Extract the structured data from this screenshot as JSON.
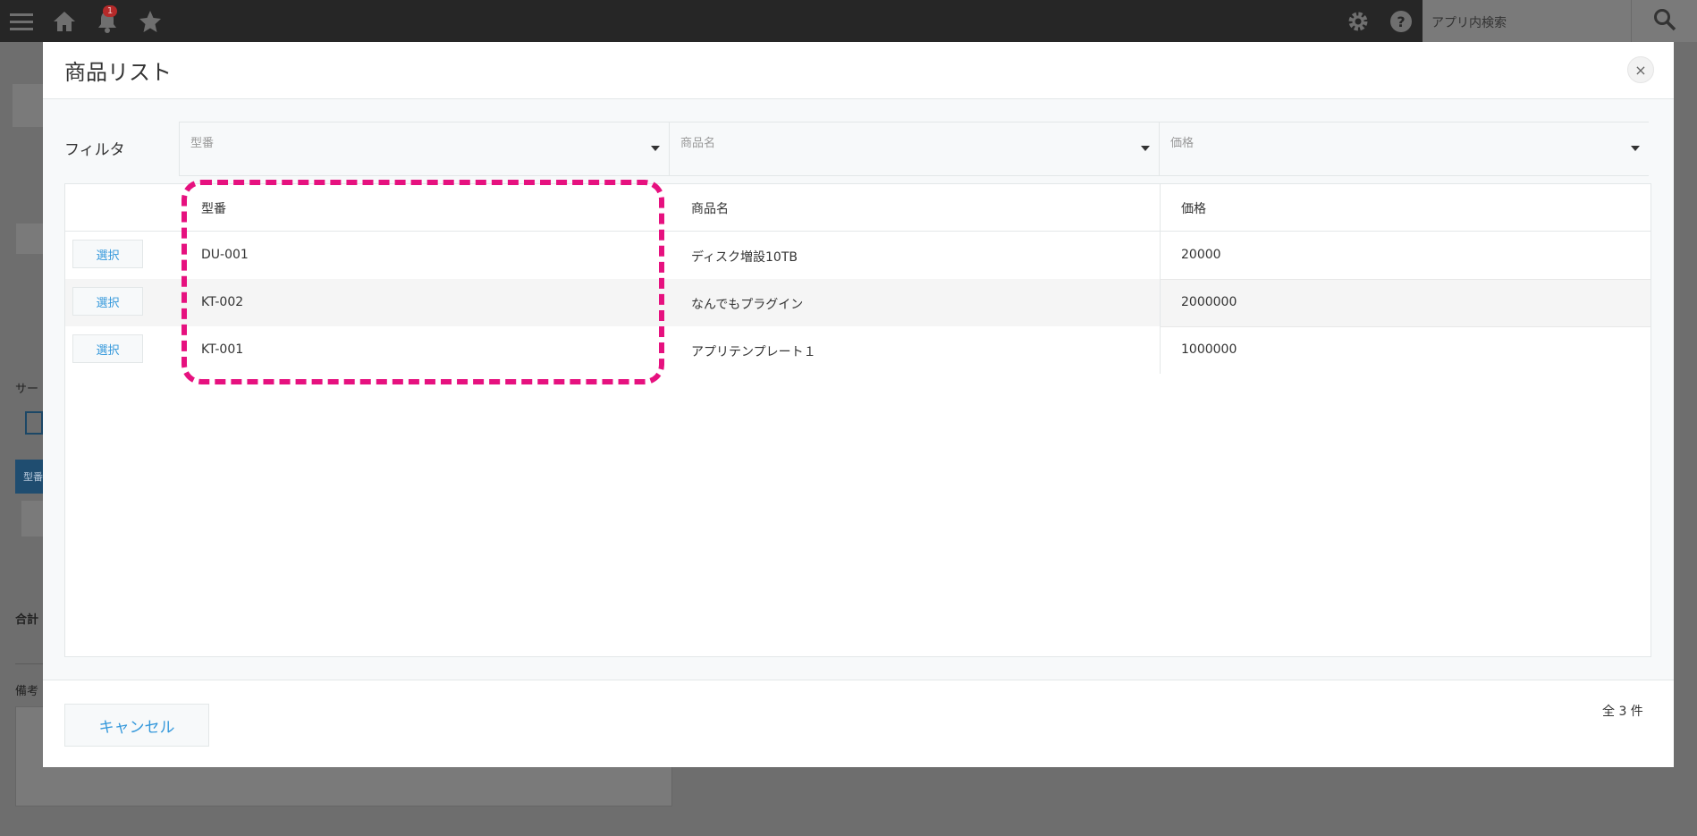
{
  "topbar": {
    "notification_count": "1",
    "search_placeholder": "アプリ内検索",
    "icons": [
      "menu-icon",
      "home-icon",
      "bell-icon",
      "star-icon",
      "gear-icon",
      "help-icon",
      "search-icon"
    ]
  },
  "modal": {
    "title": "商品リスト",
    "close_label": "×",
    "filter_label": "フィルタ",
    "filters": [
      {
        "placeholder": "型番"
      },
      {
        "placeholder": "商品名"
      },
      {
        "placeholder": "価格"
      }
    ],
    "columns": [
      "型番",
      "商品名",
      "価格"
    ],
    "select_label": "選択",
    "rows": [
      {
        "model": "DU-001",
        "name": "ディスク増設10TB",
        "price": "20000"
      },
      {
        "model": "KT-002",
        "name": "なんでもプラグイン",
        "price": "2000000"
      },
      {
        "model": "KT-001",
        "name": "アプリテンプレート１",
        "price": "1000000"
      }
    ],
    "cancel_label": "キャンセル",
    "count_label": "全 3 件"
  },
  "background": {
    "labels": [
      "サー",
      "型番",
      "合計",
      "備考"
    ]
  },
  "colors": {
    "accent": "#3498db",
    "highlight": "#e6117f",
    "topbar": "#262626"
  }
}
